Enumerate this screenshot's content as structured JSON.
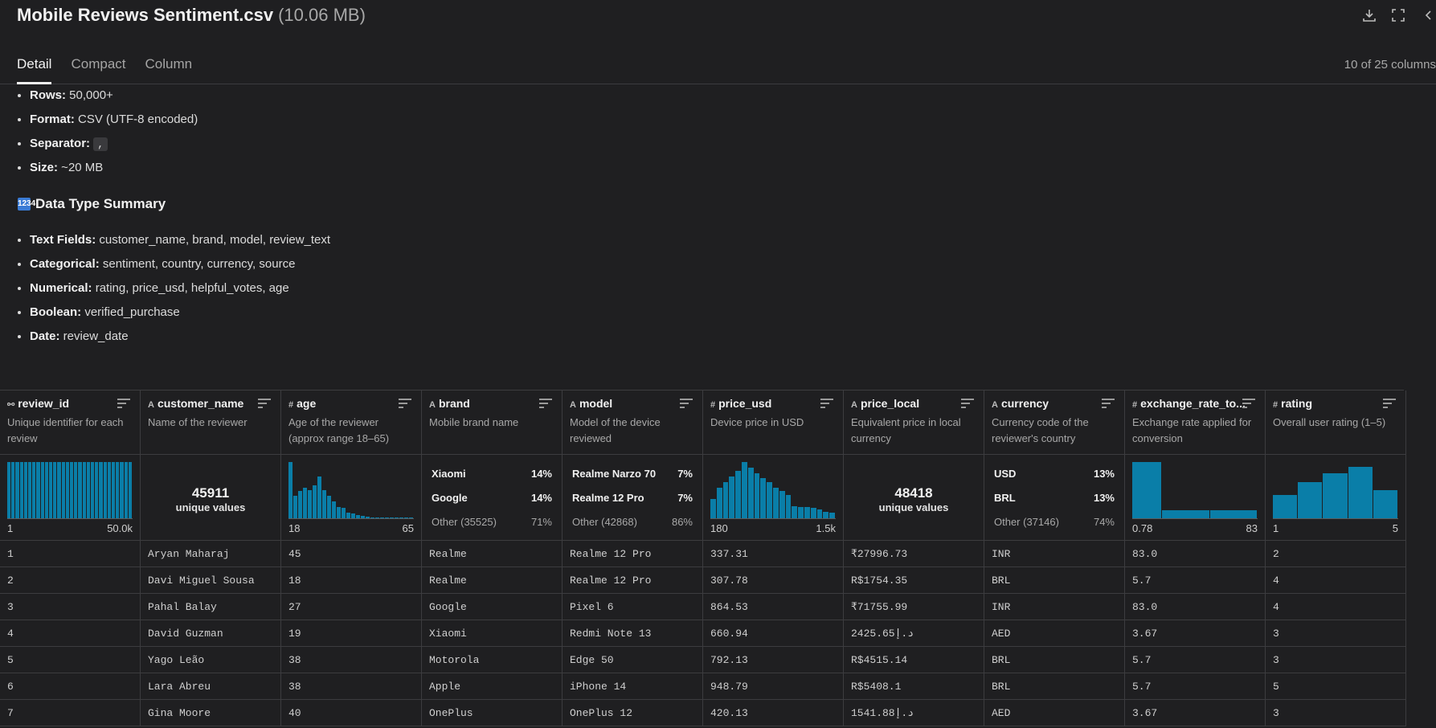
{
  "file": {
    "name": "Mobile Reviews Sentiment.csv",
    "size": "(10.06 MB)"
  },
  "tabs": [
    {
      "label": "Detail"
    },
    {
      "label": "Compact"
    },
    {
      "label": "Column"
    }
  ],
  "column_count": "10 of 25 columns",
  "summary": [
    {
      "key": "Rows:",
      "value": " 50,000+"
    },
    {
      "key": "Format:",
      "value": " CSV (UTF-8 encoded)"
    },
    {
      "key": "Separator:",
      "value": " ",
      "code": ","
    },
    {
      "key": "Size:",
      "value": " ~20 MB"
    }
  ],
  "section_title": "Data Type Summary",
  "section_icon": "1234",
  "types": [
    {
      "key": "Text Fields:",
      "value": " customer_name, brand, model, review_text"
    },
    {
      "key": "Categorical:",
      "value": " sentiment, country, currency, source"
    },
    {
      "key": "Numerical:",
      "value": " rating, price_usd, helpful_votes, age"
    },
    {
      "key": "Boolean:",
      "value": " verified_purchase"
    },
    {
      "key": "Date:",
      "value": " review_date"
    }
  ],
  "columns": [
    {
      "type_icon": "⚯",
      "name": "review_id",
      "desc": "Unique identifier for each review",
      "stats": {
        "kind": "hist",
        "bars": [
          1,
          1,
          1,
          1,
          1,
          1,
          1,
          1,
          1,
          1,
          1,
          1,
          1,
          1,
          1,
          1,
          1,
          1,
          1,
          1,
          1,
          1,
          1,
          1,
          1,
          1,
          1,
          1,
          1,
          1
        ],
        "min": "1",
        "max": "50.0k"
      }
    },
    {
      "type_icon": "A",
      "name": "customer_name",
      "desc": "Name of the reviewer",
      "stats": {
        "kind": "unique",
        "count": "45911",
        "label": "unique values"
      }
    },
    {
      "type_icon": "#",
      "name": "age",
      "desc": "Age of the reviewer (approx range 18–65)",
      "stats": {
        "kind": "hist",
        "bars": [
          1,
          0.4,
          0.48,
          0.55,
          0.5,
          0.58,
          0.75,
          0.5,
          0.4,
          0.3,
          0.2,
          0.18,
          0.1,
          0.08,
          0.06,
          0.04,
          0.03,
          0.02,
          0.02,
          0.01,
          0.01,
          0.01,
          0.01,
          0.01,
          0.01,
          0.01
        ],
        "min": "18",
        "max": "65"
      }
    },
    {
      "type_icon": "A",
      "name": "brand",
      "desc": "Mobile brand name",
      "stats": {
        "kind": "cats",
        "items": [
          {
            "name": "Xiaomi",
            "pct": "14%"
          },
          {
            "name": "Google",
            "pct": "14%"
          }
        ],
        "other": {
          "name": "Other (35525)",
          "pct": "71%"
        }
      }
    },
    {
      "type_icon": "A",
      "name": "model",
      "desc": "Model of the device reviewed",
      "stats": {
        "kind": "cats",
        "items": [
          {
            "name": "Realme Narzo 70",
            "pct": "7%"
          },
          {
            "name": "Realme 12 Pro",
            "pct": "7%"
          }
        ],
        "other": {
          "name": "Other (42868)",
          "pct": "86%"
        }
      }
    },
    {
      "type_icon": "#",
      "name": "price_usd",
      "desc": "Device price in USD",
      "stats": {
        "kind": "hist",
        "bars": [
          0.35,
          0.55,
          0.65,
          0.75,
          0.85,
          1,
          0.9,
          0.8,
          0.72,
          0.65,
          0.55,
          0.48,
          0.42,
          0.22,
          0.2,
          0.2,
          0.18,
          0.16,
          0.12,
          0.1
        ],
        "min": "180",
        "max": "1.5k"
      }
    },
    {
      "type_icon": "A",
      "name": "price_local",
      "desc": "Equivalent price in local currency",
      "stats": {
        "kind": "unique",
        "count": "48418",
        "label": "unique values"
      }
    },
    {
      "type_icon": "A",
      "name": "currency",
      "desc": "Currency code of the reviewer's country",
      "stats": {
        "kind": "cats",
        "items": [
          {
            "name": "USD",
            "pct": "13%"
          },
          {
            "name": "BRL",
            "pct": "13%"
          }
        ],
        "other": {
          "name": "Other (37146)",
          "pct": "74%"
        }
      }
    },
    {
      "type_icon": "#",
      "name": "exchange_rate_to...",
      "desc": "Exchange rate applied for conversion",
      "stats": {
        "kind": "hist",
        "bars": [
          1,
          0.15,
          0.15
        ],
        "widths": [
          1,
          1.6,
          1.6
        ],
        "min": "0.78",
        "max": "83"
      }
    },
    {
      "type_icon": "#",
      "name": "rating",
      "desc": "Overall user rating (1–5)",
      "stats": {
        "kind": "hist",
        "bars": [
          0.42,
          0.65,
          0.8,
          0.92,
          0.5
        ],
        "min": "1",
        "max": "5"
      }
    }
  ],
  "rows": [
    [
      "1",
      "Aryan Maharaj",
      "45",
      "Realme",
      "Realme 12 Pro",
      "337.31",
      "₹27996.73",
      "INR",
      "83.0",
      "2"
    ],
    [
      "2",
      "Davi Miguel Sousa",
      "18",
      "Realme",
      "Realme 12 Pro",
      "307.78",
      "R$1754.35",
      "BRL",
      "5.7",
      "4"
    ],
    [
      "3",
      "Pahal Balay",
      "27",
      "Google",
      "Pixel 6",
      "864.53",
      "₹71755.99",
      "INR",
      "83.0",
      "4"
    ],
    [
      "4",
      "David Guzman",
      "19",
      "Xiaomi",
      "Redmi Note 13",
      "660.94",
      "2425.65د.إ",
      "AED",
      "3.67",
      "3"
    ],
    [
      "5",
      "Yago Leão",
      "38",
      "Motorola",
      "Edge 50",
      "792.13",
      "R$4515.14",
      "BRL",
      "5.7",
      "3"
    ],
    [
      "6",
      "Lara Abreu",
      "38",
      "Apple",
      "iPhone 14",
      "948.79",
      "R$5408.1",
      "BRL",
      "5.7",
      "5"
    ],
    [
      "7",
      "Gina Moore",
      "40",
      "OnePlus",
      "OnePlus 12",
      "420.13",
      "1541.88د.إ",
      "AED",
      "3.67",
      "3"
    ]
  ]
}
